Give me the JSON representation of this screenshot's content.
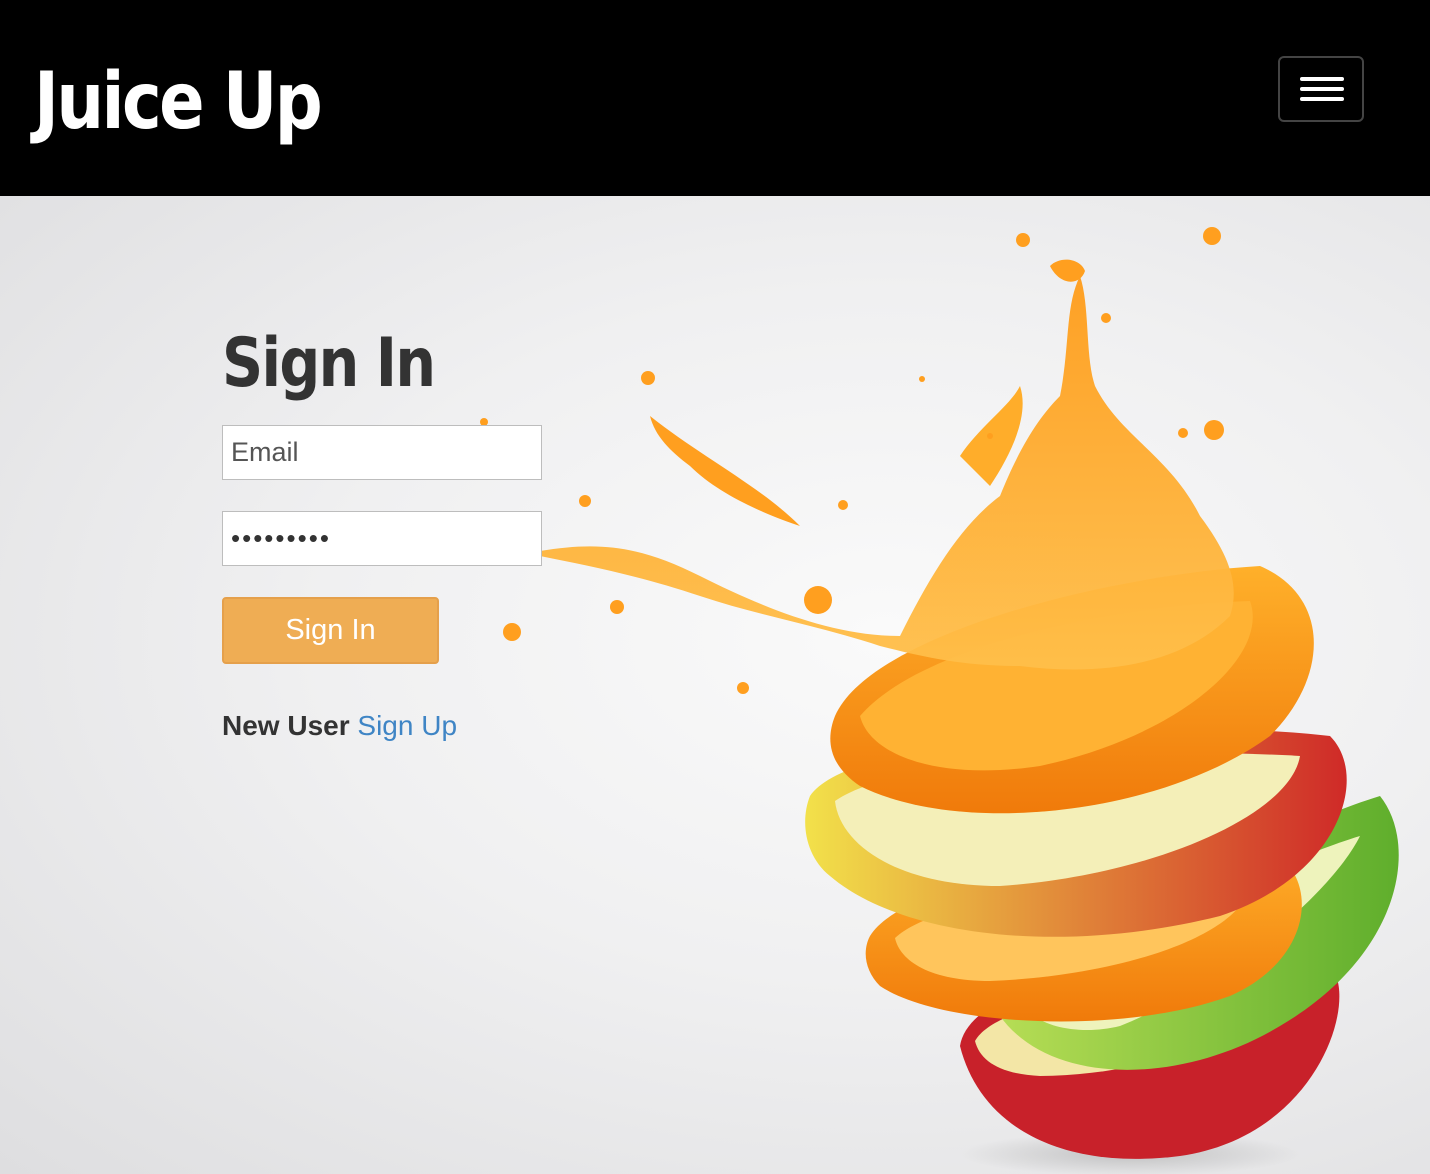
{
  "navbar": {
    "brand": "Juice Up",
    "menu_icon": "hamburger-menu-icon"
  },
  "signin": {
    "title": "Sign In",
    "email_placeholder": "Email",
    "password_mask": "•••••••••",
    "submit_label": "Sign In",
    "new_user_label": "New User",
    "signup_link": "Sign Up"
  },
  "colors": {
    "navbar_bg": "#000000",
    "button_bg": "#efad54",
    "link": "#3f85c5",
    "title_text": "#333333"
  },
  "hero_image": "juice-splash-fruit-stack"
}
